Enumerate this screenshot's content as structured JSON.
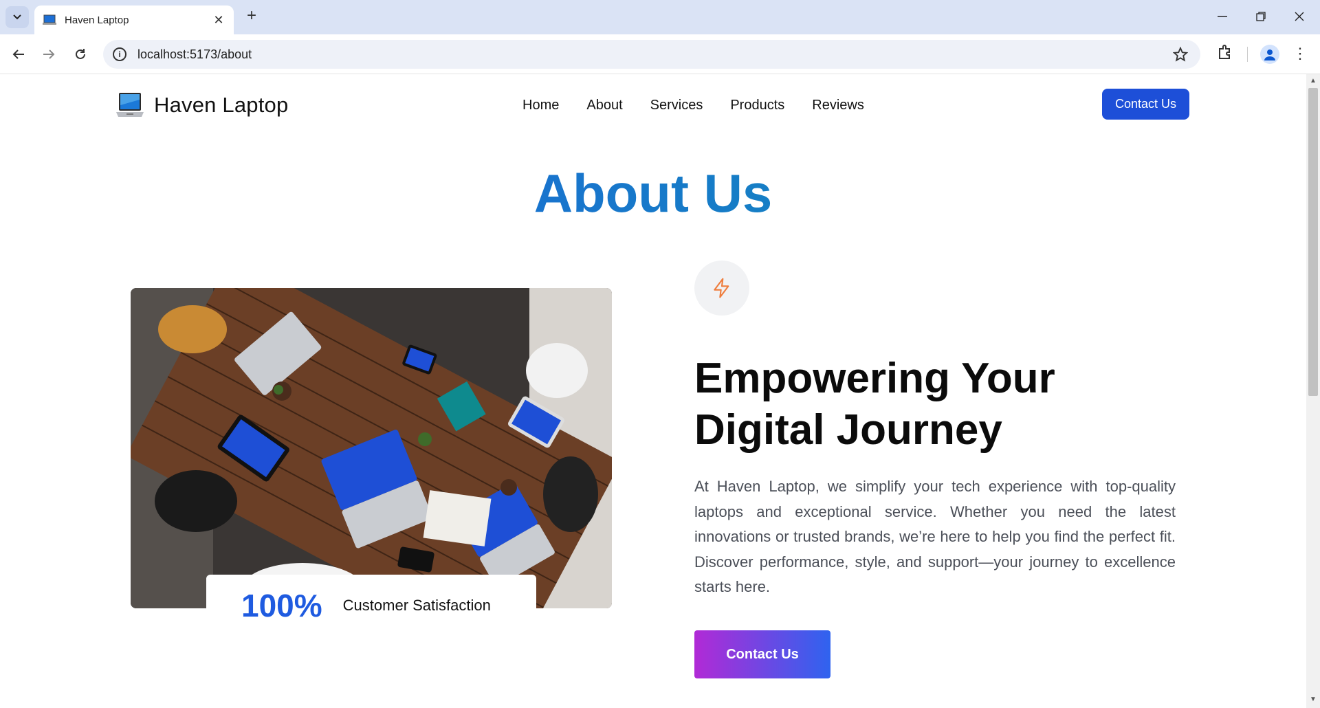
{
  "browser": {
    "tab_title": "Haven Laptop",
    "url": "localhost:5173/about"
  },
  "header": {
    "brand": "Haven Laptop",
    "nav": [
      "Home",
      "About",
      "Services",
      "Products",
      "Reviews"
    ],
    "cta": "Contact Us"
  },
  "main": {
    "title": "About Us",
    "stat": {
      "value": "100%",
      "label": "Customer Satisfaction"
    },
    "heading": "Empowering Your Digital Journey",
    "paragraph": "At Haven Laptop, we simplify your tech experience with top-quality laptops and exceptional service. Whether you need the latest innovations or trusted brands, we’re here to help you find the perfect fit. Discover performance, style, and support—your journey to excellence starts here.",
    "cta": "Contact Us"
  },
  "icons": {
    "brand": "laptop-icon",
    "feature": "lightning-icon"
  },
  "colors": {
    "primary": "#1d4fd8",
    "title_gradient": [
      "#1f5be0",
      "#0f97b3"
    ],
    "button_gradient": [
      "#b12ad6",
      "#2f63ef"
    ],
    "feature_icon": "#ef7d3c"
  }
}
